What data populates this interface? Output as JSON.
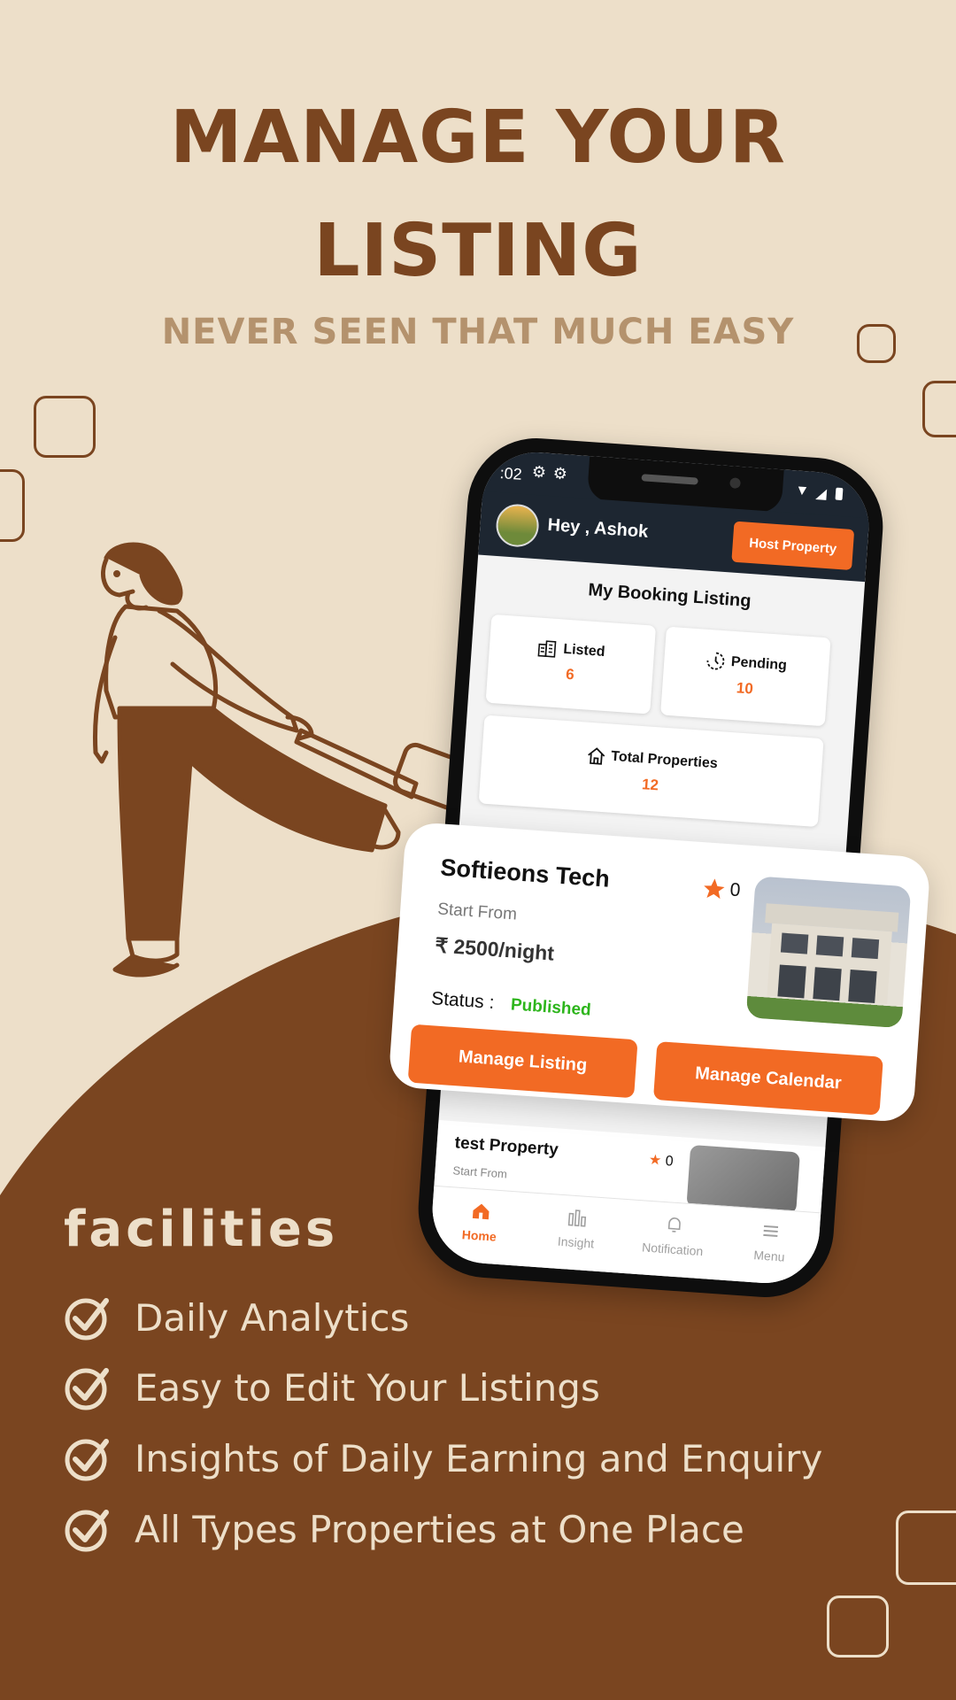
{
  "hero": {
    "title_line1": "MANAGE YOUR",
    "title_line2": "LISTING",
    "subtitle": "NEVER SEEN THAT MUCH EASY"
  },
  "phone": {
    "status_time": ":02",
    "greeting": "Hey , Ashok",
    "host_button": "Host Property",
    "section_title": "My Booking Listing",
    "stats": {
      "listed": {
        "label": "Listed",
        "value": "6"
      },
      "pending": {
        "label": "Pending",
        "value": "10"
      },
      "total": {
        "label": "Total Properties",
        "value": "12"
      }
    },
    "second_listing": {
      "title": "test Property",
      "rating": "0",
      "start_from": "Start From"
    },
    "nav": {
      "home": "Home",
      "insight": "Insight",
      "notification": "Notification",
      "menu": "Menu"
    }
  },
  "listing_card": {
    "title": "Softieons Tech",
    "rating": "0",
    "start_from": "Start From",
    "price": "₹ 2500/night",
    "status_label": "Status :",
    "status_value": "Published",
    "manage_listing": "Manage Listing",
    "manage_calendar": "Manage Calendar"
  },
  "facilities": {
    "title": "facilities",
    "items": [
      "Daily Analytics",
      "Easy to Edit Your Listings",
      "Insights of Daily Earning and Enquiry",
      "All Types Properties at One Place"
    ]
  },
  "colors": {
    "background": "#EDDFC9",
    "brown": "#7A4520",
    "accent": "#F26A24",
    "header": "#1D2631",
    "published": "#2DB51C"
  }
}
